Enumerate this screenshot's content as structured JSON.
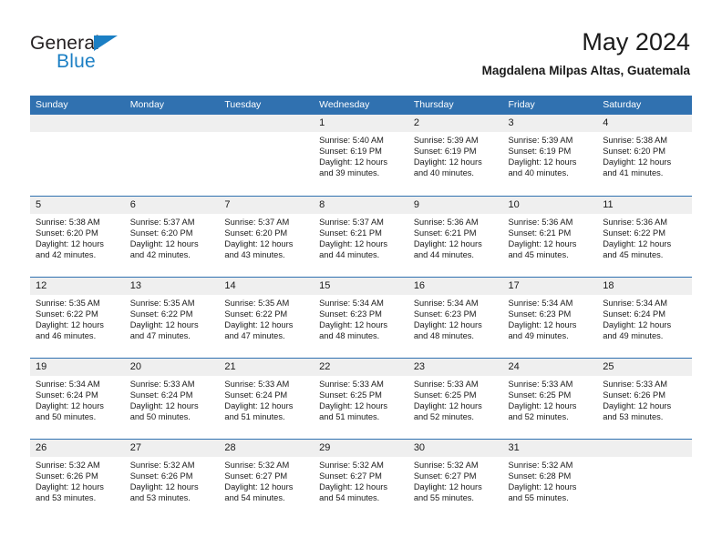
{
  "brand": {
    "name_top": "General",
    "name_bottom": "Blue",
    "accent_color": "#1b7fc4"
  },
  "header": {
    "title": "May 2024",
    "subtitle": "Magdalena Milpas Altas, Guatemala"
  },
  "theme": {
    "header_blue": "#3071b0",
    "daynum_band": "#efefef",
    "text": "#1a1a1a"
  },
  "weekdays": [
    "Sunday",
    "Monday",
    "Tuesday",
    "Wednesday",
    "Thursday",
    "Friday",
    "Saturday"
  ],
  "weeks": [
    [
      {
        "day": "",
        "empty": true
      },
      {
        "day": "",
        "empty": true
      },
      {
        "day": "",
        "empty": true
      },
      {
        "day": "1",
        "sunrise": "Sunrise: 5:40 AM",
        "sunset": "Sunset: 6:19 PM",
        "daylight_1": "Daylight: 12 hours",
        "daylight_2": "and 39 minutes."
      },
      {
        "day": "2",
        "sunrise": "Sunrise: 5:39 AM",
        "sunset": "Sunset: 6:19 PM",
        "daylight_1": "Daylight: 12 hours",
        "daylight_2": "and 40 minutes."
      },
      {
        "day": "3",
        "sunrise": "Sunrise: 5:39 AM",
        "sunset": "Sunset: 6:19 PM",
        "daylight_1": "Daylight: 12 hours",
        "daylight_2": "and 40 minutes."
      },
      {
        "day": "4",
        "sunrise": "Sunrise: 5:38 AM",
        "sunset": "Sunset: 6:20 PM",
        "daylight_1": "Daylight: 12 hours",
        "daylight_2": "and 41 minutes."
      }
    ],
    [
      {
        "day": "5",
        "sunrise": "Sunrise: 5:38 AM",
        "sunset": "Sunset: 6:20 PM",
        "daylight_1": "Daylight: 12 hours",
        "daylight_2": "and 42 minutes."
      },
      {
        "day": "6",
        "sunrise": "Sunrise: 5:37 AM",
        "sunset": "Sunset: 6:20 PM",
        "daylight_1": "Daylight: 12 hours",
        "daylight_2": "and 42 minutes."
      },
      {
        "day": "7",
        "sunrise": "Sunrise: 5:37 AM",
        "sunset": "Sunset: 6:20 PM",
        "daylight_1": "Daylight: 12 hours",
        "daylight_2": "and 43 minutes."
      },
      {
        "day": "8",
        "sunrise": "Sunrise: 5:37 AM",
        "sunset": "Sunset: 6:21 PM",
        "daylight_1": "Daylight: 12 hours",
        "daylight_2": "and 44 minutes."
      },
      {
        "day": "9",
        "sunrise": "Sunrise: 5:36 AM",
        "sunset": "Sunset: 6:21 PM",
        "daylight_1": "Daylight: 12 hours",
        "daylight_2": "and 44 minutes."
      },
      {
        "day": "10",
        "sunrise": "Sunrise: 5:36 AM",
        "sunset": "Sunset: 6:21 PM",
        "daylight_1": "Daylight: 12 hours",
        "daylight_2": "and 45 minutes."
      },
      {
        "day": "11",
        "sunrise": "Sunrise: 5:36 AM",
        "sunset": "Sunset: 6:22 PM",
        "daylight_1": "Daylight: 12 hours",
        "daylight_2": "and 45 minutes."
      }
    ],
    [
      {
        "day": "12",
        "sunrise": "Sunrise: 5:35 AM",
        "sunset": "Sunset: 6:22 PM",
        "daylight_1": "Daylight: 12 hours",
        "daylight_2": "and 46 minutes."
      },
      {
        "day": "13",
        "sunrise": "Sunrise: 5:35 AM",
        "sunset": "Sunset: 6:22 PM",
        "daylight_1": "Daylight: 12 hours",
        "daylight_2": "and 47 minutes."
      },
      {
        "day": "14",
        "sunrise": "Sunrise: 5:35 AM",
        "sunset": "Sunset: 6:22 PM",
        "daylight_1": "Daylight: 12 hours",
        "daylight_2": "and 47 minutes."
      },
      {
        "day": "15",
        "sunrise": "Sunrise: 5:34 AM",
        "sunset": "Sunset: 6:23 PM",
        "daylight_1": "Daylight: 12 hours",
        "daylight_2": "and 48 minutes."
      },
      {
        "day": "16",
        "sunrise": "Sunrise: 5:34 AM",
        "sunset": "Sunset: 6:23 PM",
        "daylight_1": "Daylight: 12 hours",
        "daylight_2": "and 48 minutes."
      },
      {
        "day": "17",
        "sunrise": "Sunrise: 5:34 AM",
        "sunset": "Sunset: 6:23 PM",
        "daylight_1": "Daylight: 12 hours",
        "daylight_2": "and 49 minutes."
      },
      {
        "day": "18",
        "sunrise": "Sunrise: 5:34 AM",
        "sunset": "Sunset: 6:24 PM",
        "daylight_1": "Daylight: 12 hours",
        "daylight_2": "and 49 minutes."
      }
    ],
    [
      {
        "day": "19",
        "sunrise": "Sunrise: 5:34 AM",
        "sunset": "Sunset: 6:24 PM",
        "daylight_1": "Daylight: 12 hours",
        "daylight_2": "and 50 minutes."
      },
      {
        "day": "20",
        "sunrise": "Sunrise: 5:33 AM",
        "sunset": "Sunset: 6:24 PM",
        "daylight_1": "Daylight: 12 hours",
        "daylight_2": "and 50 minutes."
      },
      {
        "day": "21",
        "sunrise": "Sunrise: 5:33 AM",
        "sunset": "Sunset: 6:24 PM",
        "daylight_1": "Daylight: 12 hours",
        "daylight_2": "and 51 minutes."
      },
      {
        "day": "22",
        "sunrise": "Sunrise: 5:33 AM",
        "sunset": "Sunset: 6:25 PM",
        "daylight_1": "Daylight: 12 hours",
        "daylight_2": "and 51 minutes."
      },
      {
        "day": "23",
        "sunrise": "Sunrise: 5:33 AM",
        "sunset": "Sunset: 6:25 PM",
        "daylight_1": "Daylight: 12 hours",
        "daylight_2": "and 52 minutes."
      },
      {
        "day": "24",
        "sunrise": "Sunrise: 5:33 AM",
        "sunset": "Sunset: 6:25 PM",
        "daylight_1": "Daylight: 12 hours",
        "daylight_2": "and 52 minutes."
      },
      {
        "day": "25",
        "sunrise": "Sunrise: 5:33 AM",
        "sunset": "Sunset: 6:26 PM",
        "daylight_1": "Daylight: 12 hours",
        "daylight_2": "and 53 minutes."
      }
    ],
    [
      {
        "day": "26",
        "sunrise": "Sunrise: 5:32 AM",
        "sunset": "Sunset: 6:26 PM",
        "daylight_1": "Daylight: 12 hours",
        "daylight_2": "and 53 minutes."
      },
      {
        "day": "27",
        "sunrise": "Sunrise: 5:32 AM",
        "sunset": "Sunset: 6:26 PM",
        "daylight_1": "Daylight: 12 hours",
        "daylight_2": "and 53 minutes."
      },
      {
        "day": "28",
        "sunrise": "Sunrise: 5:32 AM",
        "sunset": "Sunset: 6:27 PM",
        "daylight_1": "Daylight: 12 hours",
        "daylight_2": "and 54 minutes."
      },
      {
        "day": "29",
        "sunrise": "Sunrise: 5:32 AM",
        "sunset": "Sunset: 6:27 PM",
        "daylight_1": "Daylight: 12 hours",
        "daylight_2": "and 54 minutes."
      },
      {
        "day": "30",
        "sunrise": "Sunrise: 5:32 AM",
        "sunset": "Sunset: 6:27 PM",
        "daylight_1": "Daylight: 12 hours",
        "daylight_2": "and 55 minutes."
      },
      {
        "day": "31",
        "sunrise": "Sunrise: 5:32 AM",
        "sunset": "Sunset: 6:28 PM",
        "daylight_1": "Daylight: 12 hours",
        "daylight_2": "and 55 minutes."
      },
      {
        "day": "",
        "empty": true
      }
    ]
  ]
}
